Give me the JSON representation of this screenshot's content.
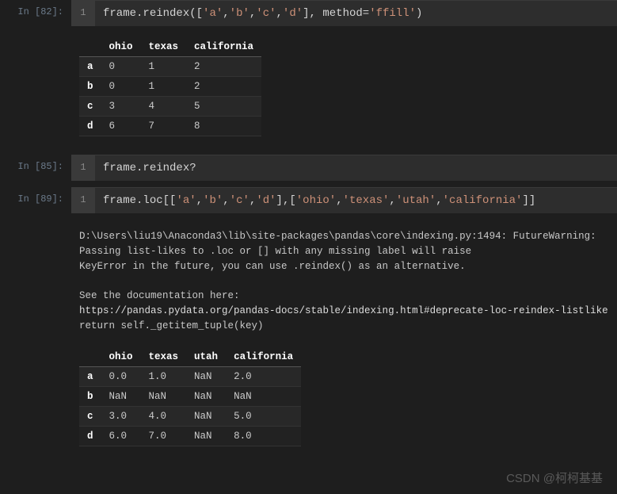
{
  "cells": [
    {
      "prompt": "In [82]:",
      "gutter": "1",
      "code_tokens": [
        {
          "t": "frame",
          "c": "tk-id"
        },
        {
          "t": ".",
          "c": "tk-punc"
        },
        {
          "t": "reindex",
          "c": "tk-id"
        },
        {
          "t": "(",
          "c": "tk-punc"
        },
        {
          "t": "[",
          "c": "tk-punc"
        },
        {
          "t": "'a'",
          "c": "tk-str"
        },
        {
          "t": ",",
          "c": "tk-punc"
        },
        {
          "t": "'b'",
          "c": "tk-str"
        },
        {
          "t": ",",
          "c": "tk-punc"
        },
        {
          "t": "'c'",
          "c": "tk-str"
        },
        {
          "t": ",",
          "c": "tk-punc"
        },
        {
          "t": "'d'",
          "c": "tk-str"
        },
        {
          "t": "]",
          "c": "tk-punc"
        },
        {
          "t": ", ",
          "c": "tk-punc"
        },
        {
          "t": "method",
          "c": "tk-id"
        },
        {
          "t": "=",
          "c": "tk-op"
        },
        {
          "t": "'ffill'",
          "c": "tk-str"
        },
        {
          "t": ")",
          "c": "tk-punc"
        }
      ],
      "output": {
        "table": {
          "columns": [
            "ohio",
            "texas",
            "california"
          ],
          "index": [
            "a",
            "b",
            "c",
            "d"
          ],
          "rows": [
            [
              "0",
              "1",
              "2"
            ],
            [
              "0",
              "1",
              "2"
            ],
            [
              "3",
              "4",
              "5"
            ],
            [
              "6",
              "7",
              "8"
            ]
          ]
        }
      }
    },
    {
      "prompt": "In [85]:",
      "gutter": "1",
      "code_tokens": [
        {
          "t": "frame",
          "c": "tk-id"
        },
        {
          "t": ".",
          "c": "tk-punc"
        },
        {
          "t": "reindex",
          "c": "tk-id"
        },
        {
          "t": "?",
          "c": "tk-help"
        }
      ]
    },
    {
      "prompt": "In [89]:",
      "gutter": "1",
      "code_tokens": [
        {
          "t": "frame",
          "c": "tk-id"
        },
        {
          "t": ".",
          "c": "tk-punc"
        },
        {
          "t": "loc",
          "c": "tk-id"
        },
        {
          "t": "[[",
          "c": "tk-punc"
        },
        {
          "t": "'a'",
          "c": "tk-str"
        },
        {
          "t": ",",
          "c": "tk-punc"
        },
        {
          "t": "'b'",
          "c": "tk-str"
        },
        {
          "t": ",",
          "c": "tk-punc"
        },
        {
          "t": "'c'",
          "c": "tk-str"
        },
        {
          "t": ",",
          "c": "tk-punc"
        },
        {
          "t": "'d'",
          "c": "tk-str"
        },
        {
          "t": "],[",
          "c": "tk-punc"
        },
        {
          "t": "'ohio'",
          "c": "tk-str"
        },
        {
          "t": ",",
          "c": "tk-punc"
        },
        {
          "t": "'texas'",
          "c": "tk-str"
        },
        {
          "t": ",",
          "c": "tk-punc"
        },
        {
          "t": "'utah'",
          "c": "tk-str"
        },
        {
          "t": ",",
          "c": "tk-punc"
        },
        {
          "t": "'california'",
          "c": "tk-str"
        },
        {
          "t": "]]",
          "c": "tk-punc"
        }
      ],
      "output": {
        "warning": {
          "lines": [
            "D:\\Users\\liu19\\Anaconda3\\lib\\site-packages\\pandas\\core\\indexing.py:1494: FutureWarning:",
            "Passing list-likes to .loc or [] with any missing label will raise",
            "KeyError in the future, you can use .reindex() as an alternative.",
            "",
            "See the documentation here:",
            "https://pandas.pydata.org/pandas-docs/stable/indexing.html#deprecate-loc-reindex-listlike",
            "  return self._getitem_tuple(key)"
          ]
        },
        "table": {
          "columns": [
            "ohio",
            "texas",
            "utah",
            "california"
          ],
          "index": [
            "a",
            "b",
            "c",
            "d"
          ],
          "rows": [
            [
              "0.0",
              "1.0",
              "NaN",
              "2.0"
            ],
            [
              "NaN",
              "NaN",
              "NaN",
              "NaN"
            ],
            [
              "3.0",
              "4.0",
              "NaN",
              "5.0"
            ],
            [
              "6.0",
              "7.0",
              "NaN",
              "8.0"
            ]
          ]
        }
      }
    }
  ],
  "watermark": "CSDN @柯柯基基"
}
